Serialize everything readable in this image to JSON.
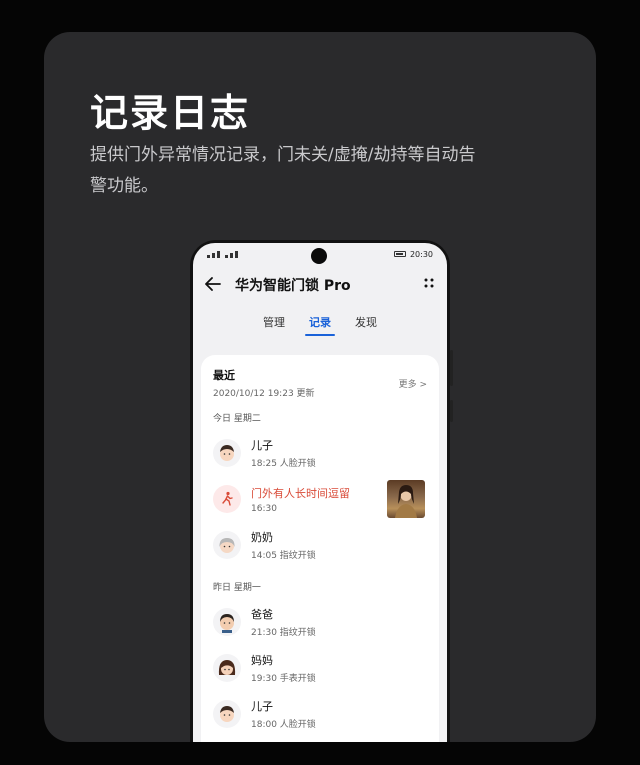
{
  "promo": {
    "title": "记录日志",
    "description": "提供门外异常情况记录，门未关/虚掩/劫持等自动告警功能。"
  },
  "status_bar": {
    "time": "20:30"
  },
  "app": {
    "back_icon": "arrow-left-icon",
    "title": "华为智能门锁 Pro",
    "menu_icon": "four-dots-icon"
  },
  "tabs": [
    {
      "label": "管理",
      "active": false
    },
    {
      "label": "记录",
      "active": true
    },
    {
      "label": "发现",
      "active": false
    }
  ],
  "recent": {
    "title": "最近",
    "updated": "2020/10/12 19:23 更新",
    "more_label": "更多 >"
  },
  "days": [
    {
      "label": "今日 星期二",
      "records": [
        {
          "name": "儿子",
          "detail": "18:25 人脸开锁",
          "icon": "boy-avatar-icon",
          "alert": false
        },
        {
          "name": "门外有人长时间逗留",
          "detail": "16:30",
          "icon": "walking-person-icon",
          "alert": true,
          "has_photo": true
        },
        {
          "name": "奶奶",
          "detail": "14:05 指纹开锁",
          "icon": "grandma-avatar-icon",
          "alert": false
        }
      ]
    },
    {
      "label": "昨日 星期一",
      "records": [
        {
          "name": "爸爸",
          "detail": "21:30 指纹开锁",
          "icon": "dad-avatar-icon",
          "alert": false
        },
        {
          "name": "妈妈",
          "detail": "19:30 手表开锁",
          "icon": "mom-avatar-icon",
          "alert": false
        },
        {
          "name": "儿子",
          "detail": "18:00 人脸开锁",
          "icon": "boy-avatar-icon",
          "alert": false
        }
      ]
    }
  ],
  "colors": {
    "accent": "#1a62d9",
    "alert": "#d94b38",
    "card_bg": "#2a2a2c"
  }
}
